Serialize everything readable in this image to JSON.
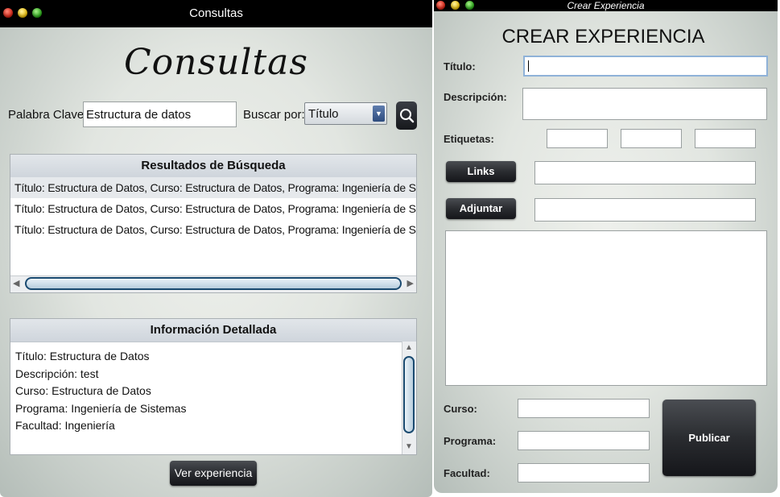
{
  "consultas": {
    "window_title": "Consultas",
    "heading": "Consultas",
    "keyword_label": "Palabra Clave:",
    "keyword_value": "Estructura de datos",
    "search_by_label": "Buscar por:",
    "search_by_selected": "Título",
    "results": {
      "header": "Resultados de Búsqueda",
      "rows": [
        "Título: Estructura de Datos, Curso: Estructura de Datos, Programa: Ingeniería de Sistemas",
        "Título: Estructura de Datos, Curso: Estructura de Datos, Programa: Ingeniería de Sistemas",
        "Título: Estructura de Datos, Curso: Estructura de Datos, Programa: Ingeniería de Sistemas"
      ]
    },
    "details": {
      "header": "Información Detallada",
      "lines": [
        "Título: Estructura de Datos",
        "Descripción: test",
        "Curso: Estructura de Datos",
        "Programa: Ingeniería de Sistemas",
        "Facultad: Ingeniería"
      ]
    },
    "view_button": "Ver experiencia"
  },
  "crear": {
    "window_title": "Crear Experiencia",
    "heading": "CREAR EXPERIENCIA",
    "titulo_label": "Título:",
    "descripcion_label": "Descripción:",
    "etiquetas_label": "Etiquetas:",
    "links_button": "Links",
    "adjuntar_button": "Adjuntar",
    "curso_label": "Curso:",
    "programa_label": "Programa:",
    "facultad_label": "Facultad:",
    "publicar_button": "Publicar"
  }
}
